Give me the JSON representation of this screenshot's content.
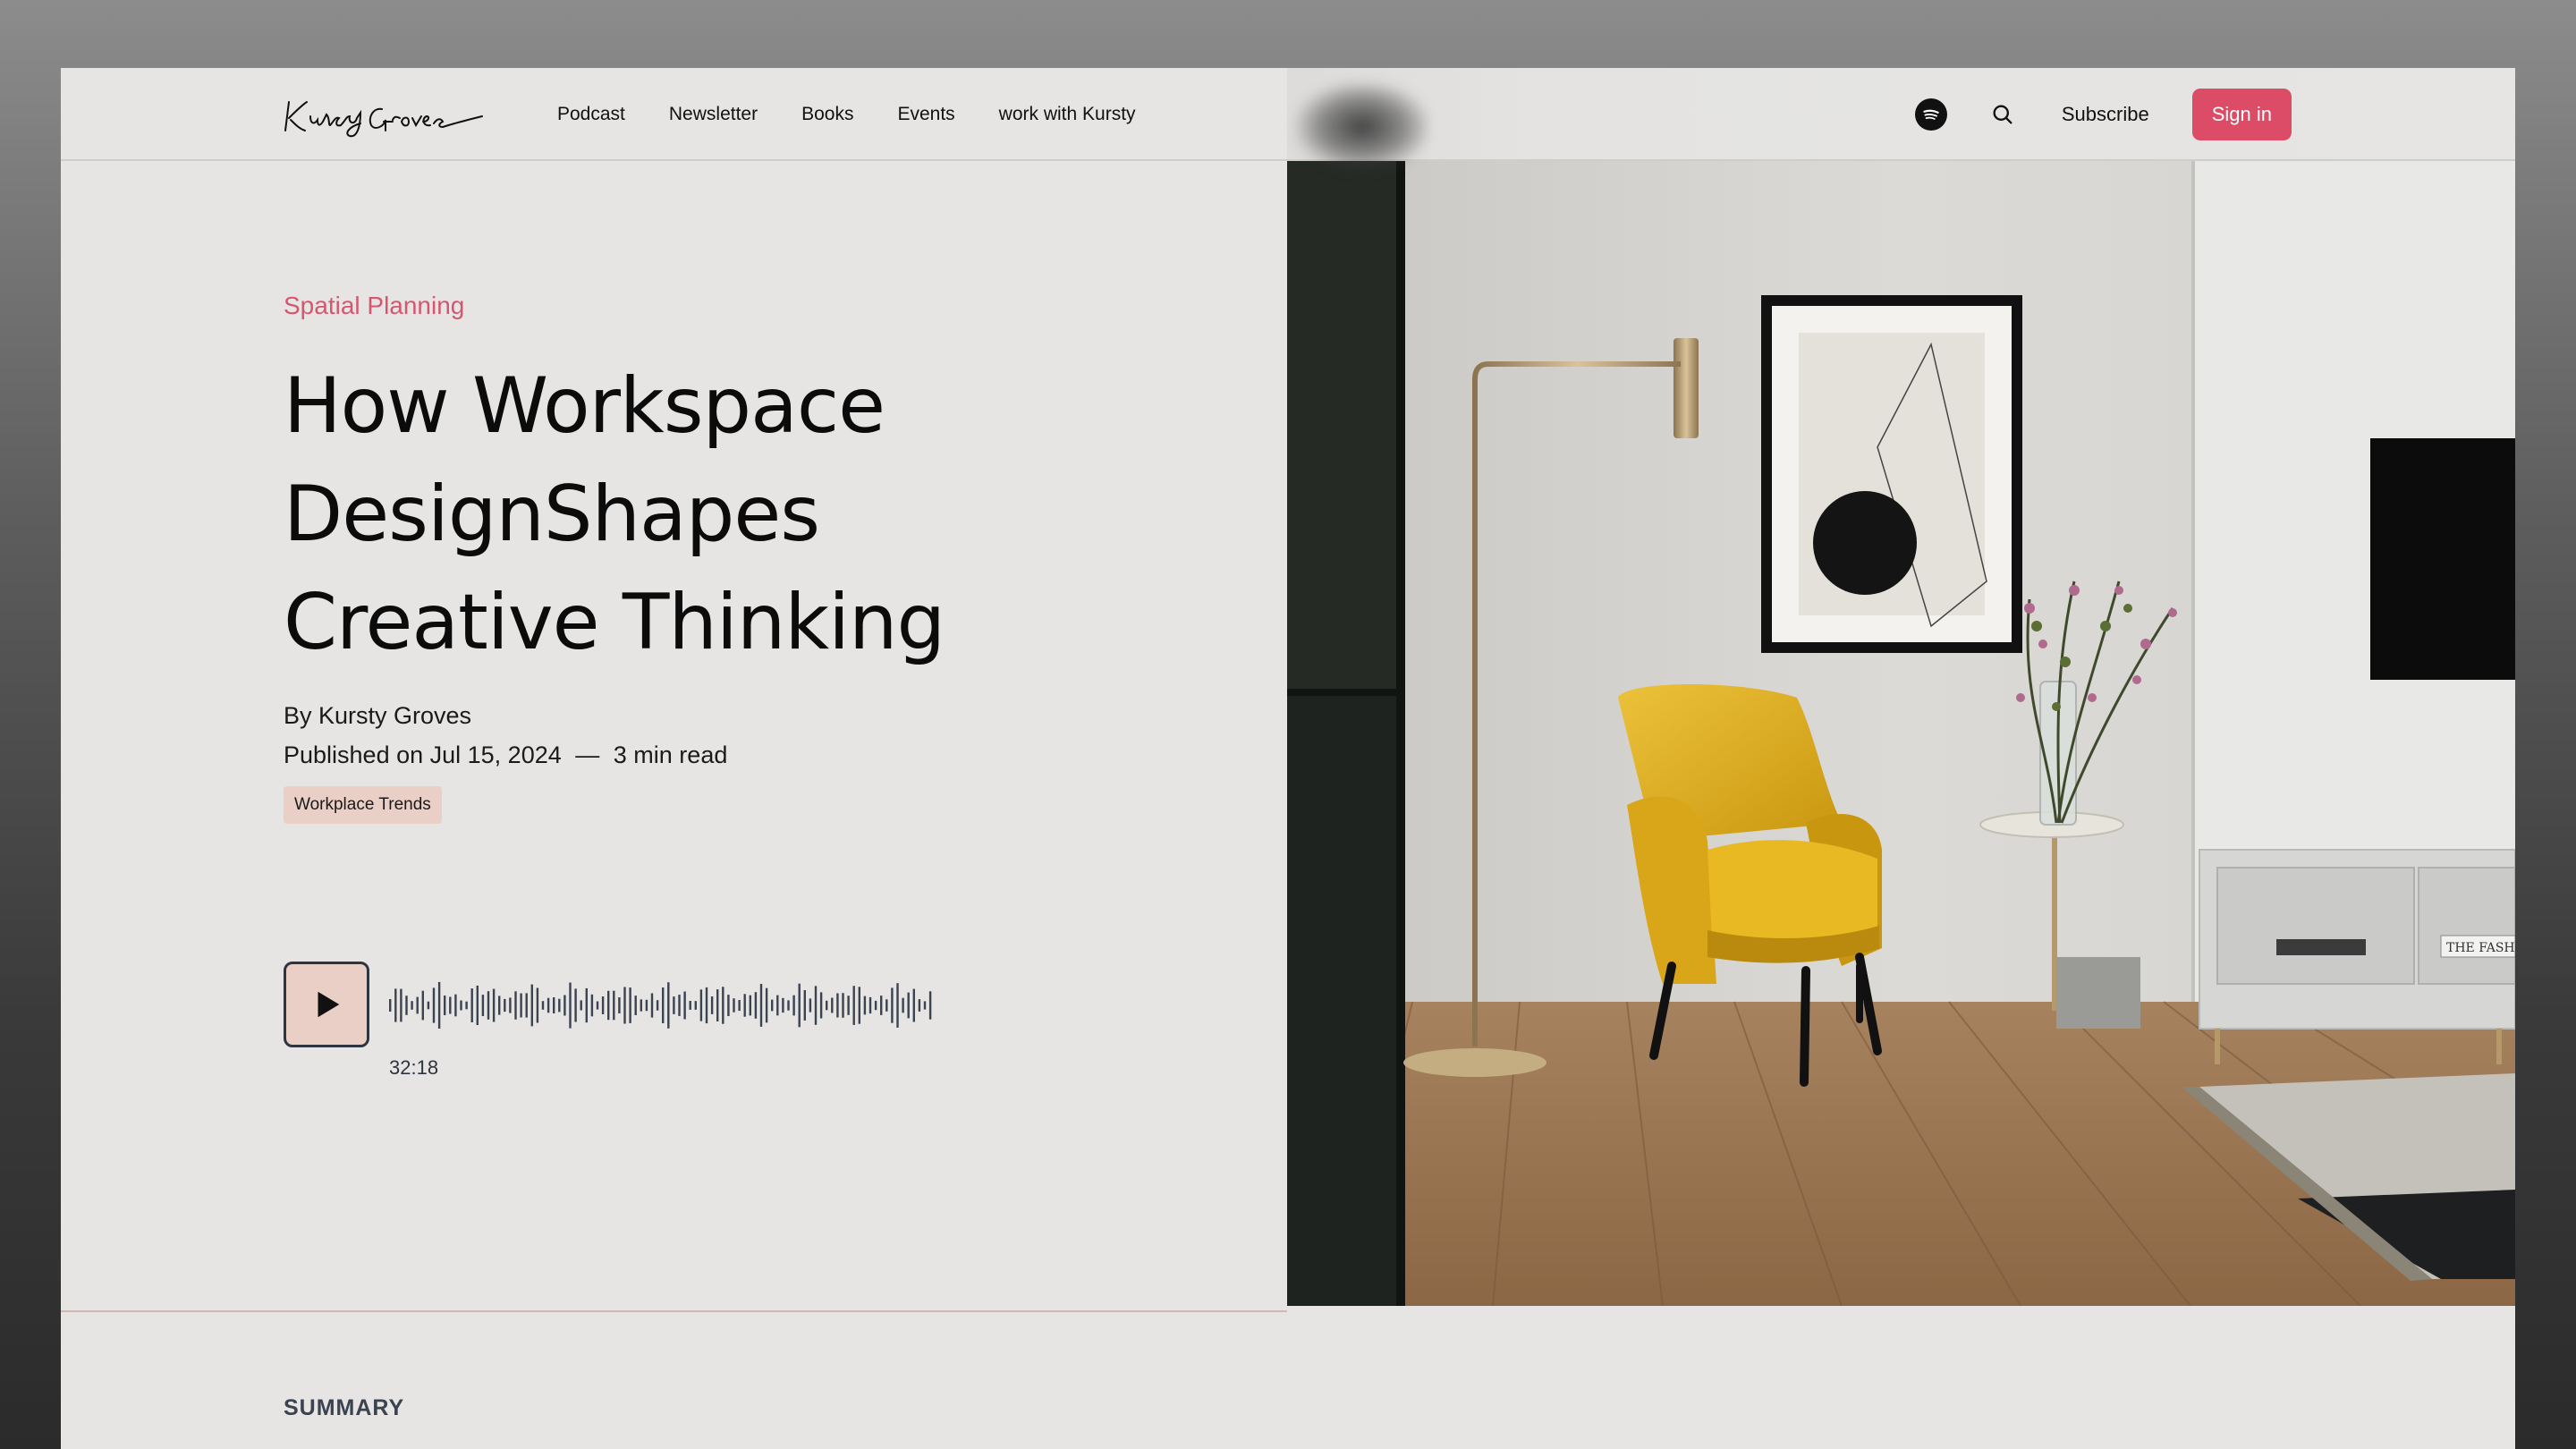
{
  "header": {
    "logo_text": "Kursty Groves",
    "nav": [
      "Podcast",
      "Newsletter",
      "Books",
      "Events",
      "work with Kursty"
    ],
    "subscribe_label": "Subscribe",
    "signin_label": "Sign in"
  },
  "article": {
    "category": "Spatial Planning",
    "title_lines": [
      "How Workspace",
      "DesignShapes",
      "Creative Thinking"
    ],
    "author": "By Kursty Groves",
    "published": "Published on Jul 15, 2024",
    "separator": "—",
    "read_time": "3 min read",
    "tag": "Workplace Trends"
  },
  "player": {
    "duration": "32:18"
  },
  "summary": {
    "heading": "SUMMARY"
  },
  "hero_image": {
    "poster_text": "THE FASH"
  },
  "colors": {
    "accent": "#dc4c67",
    "tag_bg": "#e9cfc6",
    "page_bg": "#e6e5e3",
    "chair": "#e3b627"
  }
}
